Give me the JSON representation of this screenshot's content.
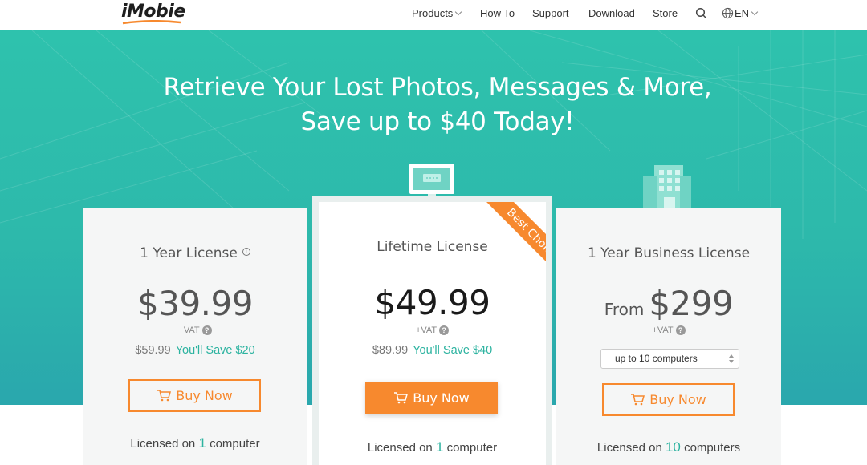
{
  "nav": {
    "logo": "iMobie",
    "items": [
      {
        "label": "Products",
        "has_dropdown": true
      },
      {
        "label": "How To"
      },
      {
        "label": "Support"
      },
      {
        "label": "Download"
      },
      {
        "label": "Store"
      }
    ],
    "search_icon": "search-icon",
    "language": "EN",
    "language_icon": "globe-icon"
  },
  "hero": {
    "title_line1": "Retrieve Your Lost Photos, Messages & More,",
    "title_line2": "Save up to $40 Today!"
  },
  "plans": [
    {
      "title": "1 Year License",
      "price": "$39.99",
      "vat": "+VAT",
      "old_price": "$59.99",
      "save": "You'll Save $20",
      "button": "Buy Now",
      "licensed_prefix": "Licensed on",
      "licensed_count": "1",
      "licensed_suffix": "computer"
    },
    {
      "title": "Lifetime License",
      "ribbon": "Best Choice",
      "price": "$49.99",
      "vat": "+VAT",
      "old_price": "$89.99",
      "save": "You'll Save $40",
      "button": "Buy Now",
      "licensed_prefix": "Licensed on",
      "licensed_count": "1",
      "licensed_suffix": "computer"
    },
    {
      "title": "1 Year Business License",
      "price_prefix": "From",
      "price": "$299",
      "vat": "+VAT",
      "select_value": "up to 10 computers",
      "button": "Buy Now",
      "licensed_prefix": "Licensed on",
      "licensed_count": "10",
      "licensed_suffix": "computers"
    }
  ],
  "colors": {
    "accent_orange": "#f7892e",
    "accent_teal": "#2cb3a0",
    "hero_teal": "#2ec2ad"
  }
}
